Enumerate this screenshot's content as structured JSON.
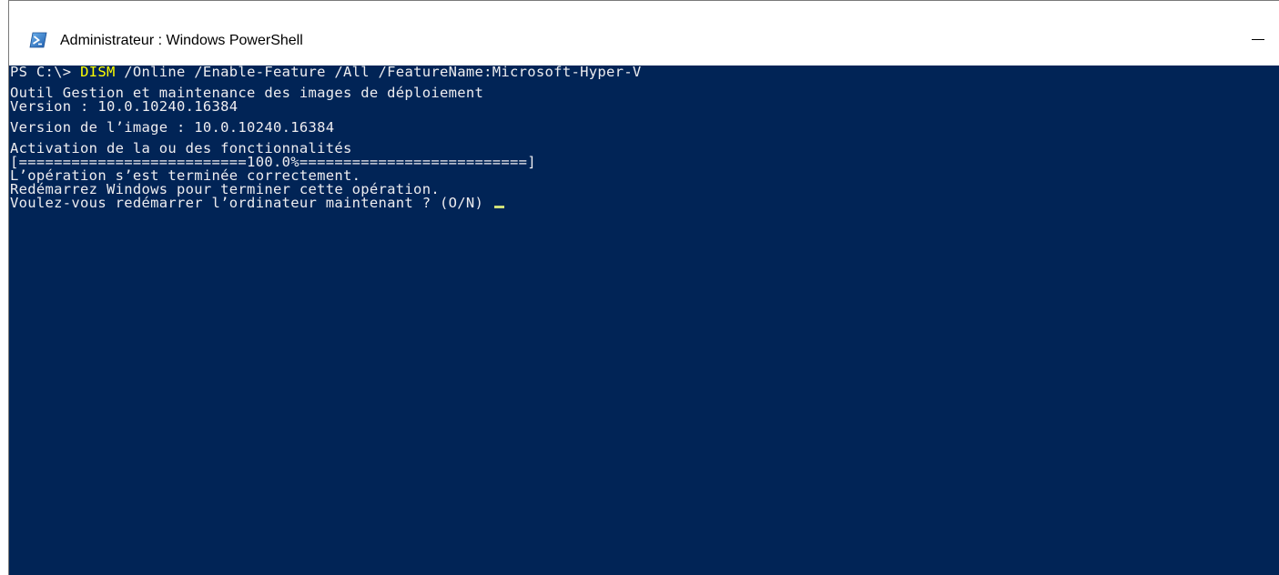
{
  "window": {
    "title": "Administrateur : Windows PowerShell",
    "icon": "powershell-icon",
    "minimize_label": "—"
  },
  "colors": {
    "console_background": "#012456",
    "console_text": "#eeedf0",
    "command_highlight": "#ffff00",
    "cursor": "#cfe07a"
  },
  "console": {
    "prompt": "PS C:\\> ",
    "command": "DISM",
    "arguments": " /Online /Enable-Feature /All /FeatureName:Microsoft-Hyper-V",
    "tool_name": "Outil Gestion et maintenance des images de déploiement",
    "tool_version": "Version : 10.0.10240.16384",
    "image_version": "Version de l’image : 10.0.10240.16384",
    "activation": "Activation de la ou des fonctionnalités",
    "progress": "[==========================100.0%==========================]",
    "result": "L’opération s’est terminée correctement.",
    "restart_notice": "Redémarrez Windows pour terminer cette opération.",
    "restart_question": "Voulez-vous redémarrer l’ordinateur maintenant ? (O/N) "
  }
}
